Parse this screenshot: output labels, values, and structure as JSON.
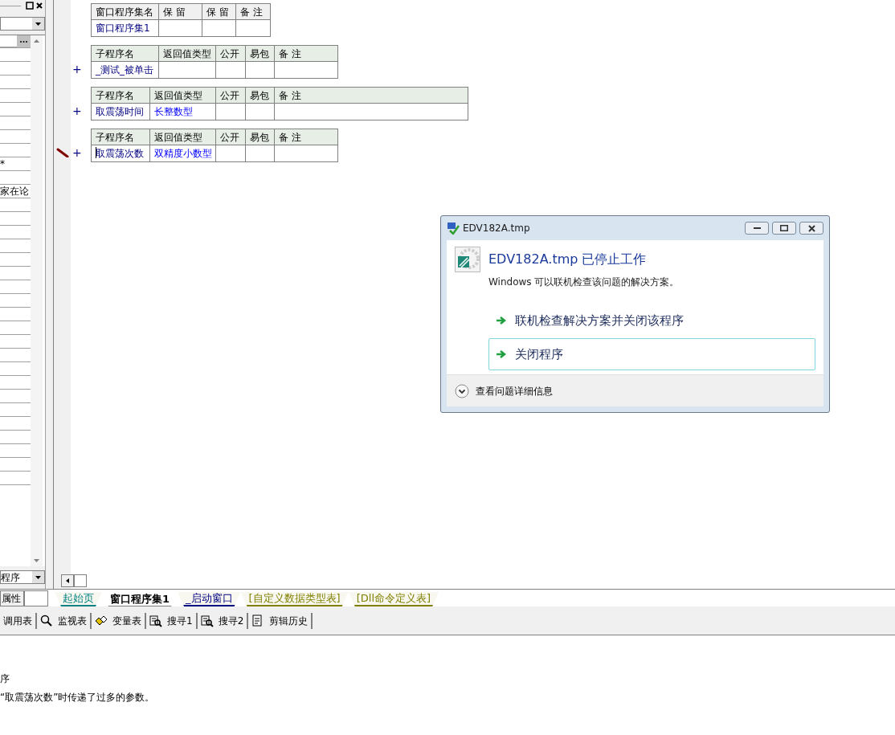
{
  "left_panel": {
    "property_rows": [
      {},
      {},
      {},
      {},
      {},
      {},
      {},
      {},
      {
        "text": "*"
      },
      {},
      {
        "text": "家在论"
      },
      {},
      {},
      {},
      {},
      {},
      {},
      {},
      {},
      {},
      {},
      {},
      {},
      {},
      {},
      {},
      {},
      {},
      {},
      {},
      {},
      {}
    ],
    "bottom_combo": {
      "value": "程序"
    },
    "tabs": [
      {
        "label": "属性",
        "selected": true
      },
      {
        "selected": false
      }
    ]
  },
  "editor": {
    "tables": [
      {
        "kind": "assembly",
        "editing": false,
        "columns": [
          "窗口程序集名",
          "保 留",
          "保 留",
          "备 注"
        ],
        "cells": [
          "窗口程序集1"
        ]
      },
      {
        "kind": "subroutine",
        "editing": false,
        "columns": [
          "子程序名",
          "返回值类型",
          "公开",
          "易包",
          "备 注"
        ],
        "cells": [
          "_测试_被单击"
        ]
      },
      {
        "kind": "subroutine",
        "editing": false,
        "columns": [
          "子程序名",
          "返回值类型",
          "公开",
          "易包",
          "备 注"
        ],
        "cells": [
          "取震荡时间",
          "长整数型"
        ]
      },
      {
        "kind": "subroutine",
        "editing": true,
        "columns": [
          "子程序名",
          "返回值类型",
          "公开",
          "易包",
          "备 注"
        ],
        "cells": [
          "取震荡次数",
          "双精度小数型"
        ]
      }
    ],
    "expand_marker": "+"
  },
  "doc_tabs": [
    {
      "label": "起始页",
      "selected": false,
      "color": "#008080"
    },
    {
      "label": "窗口程序集1",
      "selected": true,
      "color": "#000000"
    },
    {
      "label": "_启动窗口",
      "selected": false,
      "color": "#000080"
    },
    {
      "label": "[自定义数据类型表]",
      "selected": false,
      "color": "#808000"
    },
    {
      "label": "[Dll命令定义表]",
      "selected": false,
      "color": "#808000"
    }
  ],
  "toolbar": [
    {
      "label": "调用表",
      "kind": "none"
    },
    {
      "label": "监视表",
      "kind": "magnifier"
    },
    {
      "label": "变量表",
      "kind": "variables"
    },
    {
      "label": "搜寻1",
      "kind": "search"
    },
    {
      "label": "搜寻2",
      "kind": "search"
    },
    {
      "label": "剪辑历史",
      "kind": "clipboard"
    }
  ],
  "output": [
    "序",
    "“取震荡次数”时传递了过多的参数。"
  ],
  "dialog": {
    "title": "EDV182A.tmp",
    "heading": "EDV182A.tmp 已停止工作",
    "message": "Windows 可以联机检查该问题的解决方案。",
    "options": [
      {
        "label": "联机检查解决方案并关闭该程序",
        "selected": false
      },
      {
        "label": "关闭程序",
        "selected": true
      }
    ],
    "details": "查看问题详细信息"
  }
}
